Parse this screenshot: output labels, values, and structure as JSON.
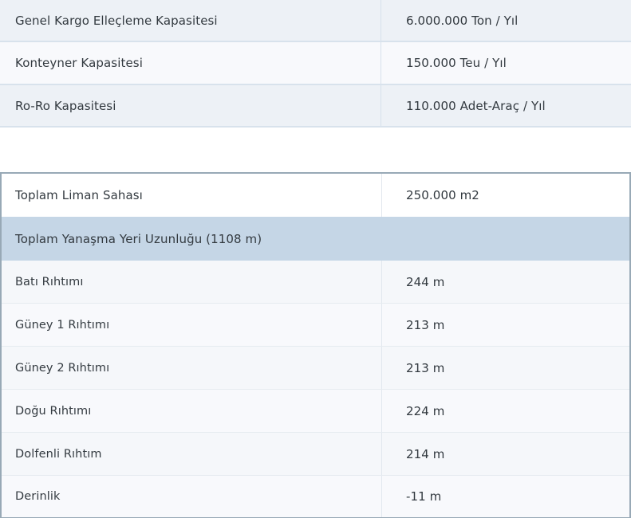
{
  "capacity_table": {
    "rows": [
      {
        "label": "Genel Kargo Elleçleme Kapasitesi",
        "value": "6.000.000 Ton / Yıl"
      },
      {
        "label": "Konteyner Kapasitesi",
        "value": "150.000 Teu / Yıl"
      },
      {
        "label": "Ro-Ro Kapasitesi",
        "value": "110.000 Adet-Araç / Yıl"
      }
    ]
  },
  "area_table": {
    "total_area": {
      "label": "Toplam Liman Sahası",
      "value": "250.000 m2"
    },
    "berth_group": {
      "label": "Toplam Yanaşma Yeri Uzunluğu  (1108 m)"
    },
    "berths": [
      {
        "label": "Batı Rıhtımı",
        "value": "244 m"
      },
      {
        "label": "Güney 1 Rıhtımı",
        "value": "213 m"
      },
      {
        "label": "Güney 2 Rıhtımı",
        "value": "213 m"
      },
      {
        "label": "Doğu Rıhtımı",
        "value": "224 m"
      },
      {
        "label": "Dolfenli Rıhtım",
        "value": "214 m"
      },
      {
        "label": "Derinlik",
        "value": "-11 m"
      }
    ]
  }
}
